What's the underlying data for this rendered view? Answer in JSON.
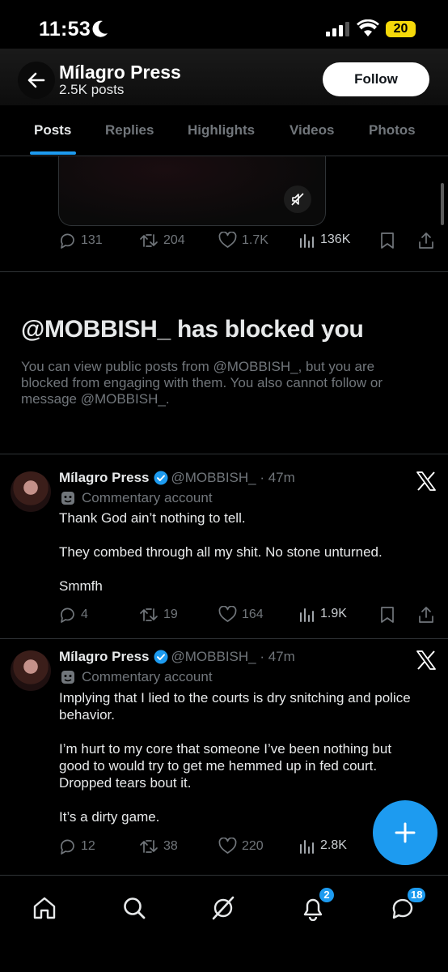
{
  "status_bar": {
    "time": "11:53",
    "battery": "20"
  },
  "header": {
    "name": "Mílagro Press",
    "post_count": "2.5K posts",
    "follow_label": "Follow"
  },
  "tabs": [
    {
      "label": "Posts",
      "active": true
    },
    {
      "label": "Replies"
    },
    {
      "label": "Highlights"
    },
    {
      "label": "Videos"
    },
    {
      "label": "Photos"
    }
  ],
  "media_post": {
    "replies": "131",
    "reposts": "204",
    "likes": "1.7K",
    "views": "136K"
  },
  "blocked": {
    "title": "@MOBBISH_ has blocked you",
    "body": "You can view public posts from @MOBBISH_, but you are blocked from engaging with them. You also cannot follow or message @MOBBISH_."
  },
  "posts": [
    {
      "name": "Mílagro Press",
      "handle": "@MOBBISH_ · 47m",
      "label": "Commentary account",
      "text": "Thank God ain’t nothing to tell.\n\nThey combed through all my shit. No stone unturned.\n\nSmmfh",
      "replies": "4",
      "reposts": "19",
      "likes": "164",
      "views": "1.9K"
    },
    {
      "name": "Mílagro Press",
      "handle": "@MOBBISH_ · 47m",
      "label": "Commentary account",
      "text": "Implying that I lied to the courts is dry snitching and police behavior.\n\nI’m hurt to my core that someone I’ve been nothing but good to would try to get me hemmed up in fed court. Dropped tears bout it.\n\nIt’s a dirty game.",
      "replies": "12",
      "reposts": "38",
      "likes": "220",
      "views": "2.8K"
    }
  ],
  "bottom_nav": {
    "notifications_badge": "2",
    "messages_badge": "18"
  },
  "colors": {
    "accent": "#1d9bf0",
    "background": "#000000",
    "muted": "#71767b",
    "divider": "#2f3336"
  },
  "icons": [
    "back-arrow-icon",
    "mute-icon",
    "reply-icon",
    "repost-icon",
    "like-icon",
    "views-icon",
    "bookmark-icon",
    "share-icon",
    "verified-icon",
    "commentary-mask-icon",
    "x-logo-icon",
    "compose-plus-icon",
    "home-icon",
    "search-icon",
    "grok-icon",
    "bell-icon",
    "messages-icon"
  ]
}
